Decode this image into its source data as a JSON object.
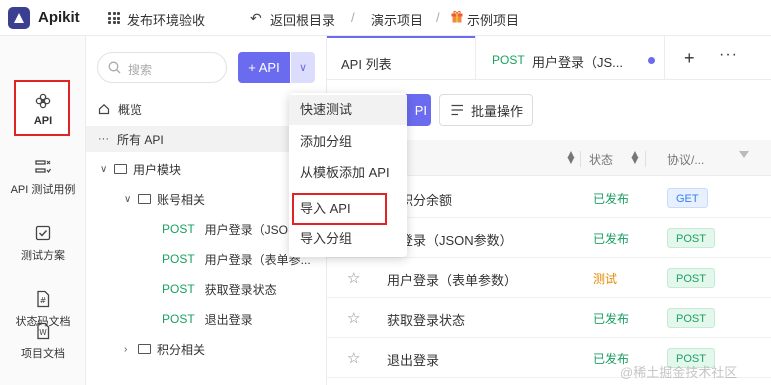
{
  "topbar": {
    "app_name": "Apikit",
    "env_label": "发布环境验收",
    "back_label": "返回根目录",
    "breadcrumb": [
      "演示项目",
      "示例项目"
    ],
    "separator": "/"
  },
  "leftnav": {
    "items": [
      {
        "label": "API",
        "icon": "api-icon",
        "active": true
      },
      {
        "label": "API 测试用例",
        "icon": "test-case-icon"
      },
      {
        "label": "测试方案",
        "icon": "test-plan-icon"
      },
      {
        "label": "状态码文档",
        "icon": "status-code-icon"
      },
      {
        "label": "项目文档",
        "icon": "project-doc-icon"
      }
    ]
  },
  "tree": {
    "search_placeholder": "搜索",
    "add_label": "+ API",
    "rows": [
      {
        "label": "概览"
      },
      {
        "label": "所有 API"
      },
      {
        "label": "用户模块"
      },
      {
        "label": "账号相关"
      },
      {
        "method": "POST",
        "label": "用户登录（JSON"
      },
      {
        "method": "POST",
        "label": "用户登录（表单参..."
      },
      {
        "method": "POST",
        "label": "获取登录状态"
      },
      {
        "method": "POST",
        "label": "退出登录"
      },
      {
        "label": "积分相关"
      }
    ]
  },
  "tabs": {
    "list_tab": "API 列表",
    "open_tab_method": "POST",
    "open_tab_title": "用户登录（JS...",
    "plus": "+",
    "more": "···"
  },
  "toolbar": {
    "partial_btn": "PI",
    "bulk_label": "批量操作"
  },
  "table": {
    "col_name": "称",
    "col_status": "状态",
    "col_protocol": "协议/...",
    "rows": [
      {
        "name": "取积分余额",
        "status": "已发布",
        "status_color": "#1aa160",
        "method": "GET"
      },
      {
        "name": "户登录（JSON参数）",
        "status": "已发布",
        "status_color": "#1aa160",
        "method": "POST"
      },
      {
        "name": "用户登录（表单参数）",
        "status": "测试",
        "status_color": "#e58a00",
        "method": "POST"
      },
      {
        "name": "获取登录状态",
        "status": "已发布",
        "status_color": "#1aa160",
        "method": "POST"
      },
      {
        "name": "退出登录",
        "status": "已发布",
        "status_color": "#1aa160",
        "method": "POST"
      }
    ]
  },
  "menu": {
    "items": [
      "快速测试",
      "添加分组",
      "从模板添加 API",
      "导入 API",
      "导入分组"
    ]
  },
  "watermark": "@稀土掘金技术社区",
  "colors": {
    "accent": "#6b6bf0",
    "highlight": "#e02424",
    "success": "#1aa160"
  }
}
